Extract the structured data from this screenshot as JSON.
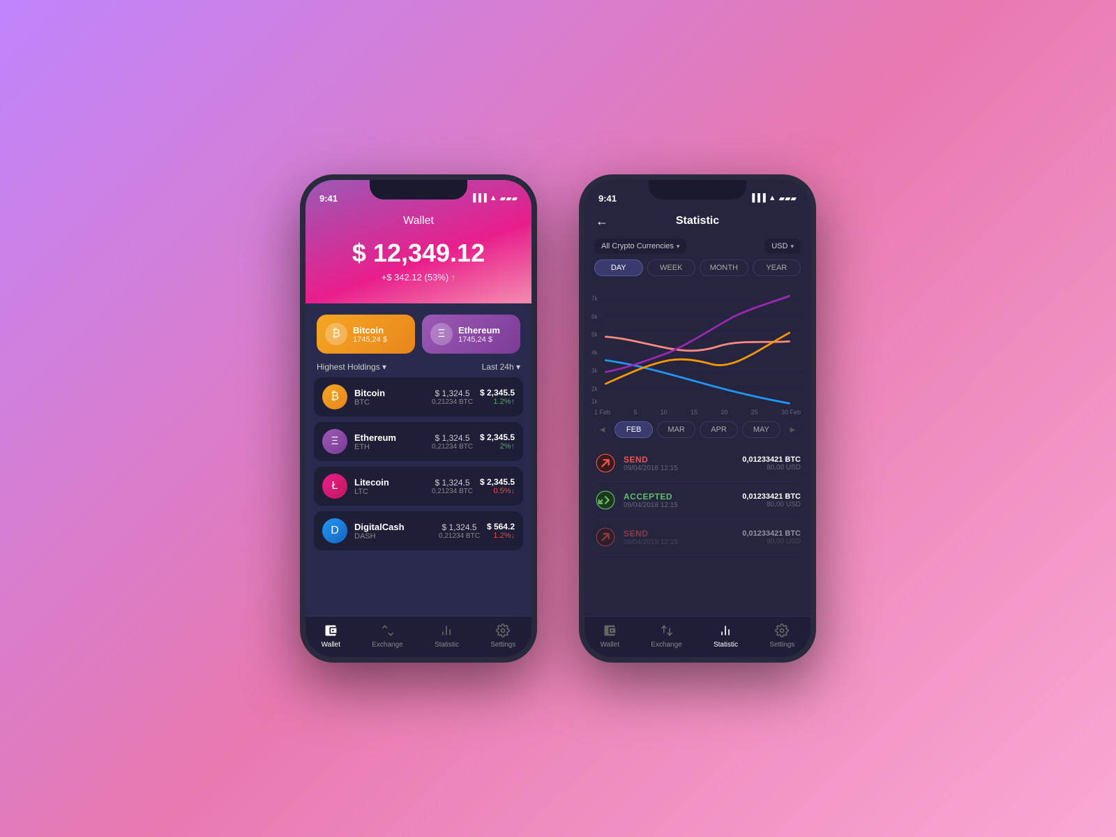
{
  "background_gradient": "135deg, #c084fc 0%, #e879b0 50%, #f9a8d4 100%",
  "phone1": {
    "status_time": "9:41",
    "title": "Wallet",
    "balance": "$ 12,349.12",
    "change": "+$ 342.12 (53%)",
    "change_arrow": "↑",
    "crypto_cards": [
      {
        "id": "btc",
        "name": "Bitcoin",
        "value": "1745,24 $",
        "icon": "₿",
        "class": "btc"
      },
      {
        "id": "eth",
        "name": "Ethereum",
        "value": "1745,24 $",
        "icon": "Ξ",
        "class": "eth"
      }
    ],
    "holdings_label": "Highest Holdings ▾",
    "period_label": "Last 24h ▾",
    "coins": [
      {
        "id": "btc",
        "name": "Bitcoin",
        "sym": "BTC",
        "icon": "₿",
        "class": "btc",
        "usd": "$ 1,324.5",
        "btc": "0,21234 BTC",
        "total": "$ 2,345.5",
        "pct": "1.2%↑",
        "up": true
      },
      {
        "id": "eth",
        "name": "Ethereum",
        "sym": "ETH",
        "icon": "Ξ",
        "class": "eth",
        "usd": "$ 1,324.5",
        "btc": "0,21234 BTC",
        "total": "$ 2,345.5",
        "pct": "2%↑",
        "up": true
      },
      {
        "id": "ltc",
        "name": "Litecoin",
        "sym": "LTC",
        "icon": "Ł",
        "class": "ltc",
        "usd": "$ 1,324.5",
        "btc": "0,21234 BTC",
        "total": "$ 2,345.5",
        "pct": "0.5%↓",
        "up": false
      },
      {
        "id": "dash",
        "name": "DigitalCash",
        "sym": "DASH",
        "icon": "D",
        "class": "dash",
        "usd": "$ 1,324.5",
        "btc": "0,21234 BTC",
        "total": "$ 564.2",
        "pct": "1.2%↓",
        "up": false
      }
    ],
    "nav_items": [
      {
        "id": "wallet",
        "label": "Wallet",
        "icon": "👛",
        "active": true
      },
      {
        "id": "exchange",
        "label": "Exchange",
        "icon": "⇄"
      },
      {
        "id": "statistic",
        "label": "Statistic",
        "icon": "📊"
      },
      {
        "id": "settings",
        "label": "Settings",
        "icon": "⚙️"
      }
    ]
  },
  "phone2": {
    "status_time": "9:41",
    "title": "Statistic",
    "back_label": "←",
    "currency_filter": "All Crypto Currencies",
    "currency_unit": "USD",
    "time_tabs": [
      "DAY",
      "WEEK",
      "MONTH",
      "YEAR"
    ],
    "active_time_tab": "DAY",
    "chart_y_labels": [
      "7k",
      "6k",
      "5k",
      "4k",
      "3k",
      "2k",
      "1k"
    ],
    "chart_x_labels": [
      "1 Feb",
      "5",
      "10",
      "15",
      "20",
      "25",
      "30 Feb"
    ],
    "month_tabs_prefix": [
      "◀"
    ],
    "month_tabs": [
      "FEB",
      "MAR",
      "APR",
      "MAY"
    ],
    "month_tabs_suffix": [
      "▶"
    ],
    "active_month_tab": "FEB",
    "transactions": [
      {
        "type": "SEND",
        "type_class": "send",
        "date": "09/04/2018 12:15",
        "btc": "0,01233421 BTC",
        "usd": "80,00 USD",
        "icon_type": "send"
      },
      {
        "type": "ACCEPTED",
        "type_class": "accept",
        "date": "09/04/2018 12:15",
        "btc": "0,01233421 BTC",
        "usd": "80,00 USD",
        "icon_type": "accept"
      },
      {
        "type": "SEND",
        "type_class": "send",
        "date": "09/04/2018 12:15",
        "btc": "0,01233421 BTC",
        "usd": "80,00 USD",
        "icon_type": "send"
      }
    ],
    "nav_items": [
      {
        "id": "wallet",
        "label": "Wallet",
        "icon": "👛"
      },
      {
        "id": "exchange",
        "label": "Exchange",
        "icon": "⇄"
      },
      {
        "id": "statistic",
        "label": "Statistic",
        "icon": "📊",
        "active": true
      },
      {
        "id": "settings",
        "label": "Settings",
        "icon": "⚙️"
      }
    ]
  }
}
